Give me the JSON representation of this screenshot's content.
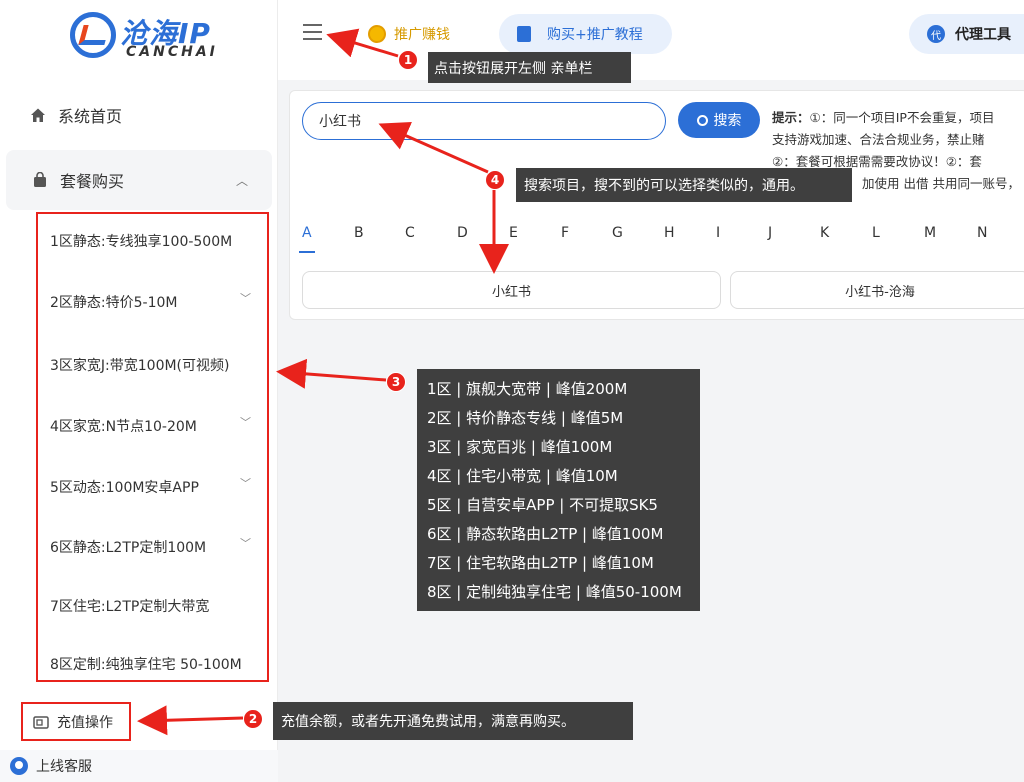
{
  "brand": {
    "title": "沧海IP",
    "subtitle": "CANCHAI"
  },
  "sidebar": {
    "home": "系统首页",
    "packages": "套餐购买",
    "zones": [
      {
        "label": "1区静态:专线独享100-500M",
        "expandable": false
      },
      {
        "label": "2区静态:特价5-10M",
        "expandable": true
      },
      {
        "label": "3区家宽J:带宽100M(可视频)",
        "expandable": false
      },
      {
        "label": "4区家宽:N节点10-20M",
        "expandable": true
      },
      {
        "label": "5区动态:100M安卓APP",
        "expandable": true
      },
      {
        "label": "6区静态:L2TP定制100M",
        "expandable": true
      },
      {
        "label": "7区住宅:L2TP定制大带宽",
        "expandable": false
      },
      {
        "label": "8区定制:纯独享住宅 50-100M",
        "expandable": false
      }
    ],
    "recharge": "充值操作",
    "service": "上线客服"
  },
  "topbar": {
    "promo": "推广赚钱",
    "tutorial": "购买+推广教程",
    "agent_tool": "代理工具",
    "agent_badge": "代"
  },
  "search": {
    "value": "小红书",
    "button": "搜索"
  },
  "tips": {
    "label": "提示：",
    "line1": "①：同一个项目IP不会重复，项目",
    "line2": "支持游戏加速、合法合规业务，禁止赌",
    "line3": "②：套餐可根据需需要改协议！②：套",
    "line4": "加使用  出借  共用同一账号，"
  },
  "letters": [
    "A",
    "B",
    "C",
    "D",
    "E",
    "F",
    "G",
    "H",
    "I",
    "J",
    "K",
    "L",
    "M",
    "N"
  ],
  "results": [
    "小红书",
    "小红书-沧海"
  ],
  "callouts": {
    "c1": {
      "num": "1",
      "text": "点击按钮展开左侧 亲单栏"
    },
    "c2": {
      "num": "2",
      "text": "充值余额，或者先开通免费试用，满意再购买。"
    },
    "c3": {
      "num": "3"
    },
    "c4": {
      "num": "4",
      "text": "搜索项目，搜不到的可以选择类似的，通用。"
    }
  },
  "zone_info": [
    "1区 | 旗舰大宽带 | 峰值200M",
    "2区 | 特价静态专线 | 峰值5M",
    "3区 | 家宽百兆 | 峰值100M",
    "4区 | 住宅小带宽 | 峰值10M",
    "5区 | 自营安卓APP | 不可提取SK5",
    "6区 | 静态软路由L2TP | 峰值100M",
    "7区 | 住宅软路由L2TP | 峰值10M",
    "8区 | 定制纯独享住宅 | 峰值50-100M"
  ],
  "colors": {
    "accent": "#2c6fd6",
    "annotation_red": "#e8231c",
    "tooltip_bg": "#3f3f3f",
    "promo": "#d69a00"
  }
}
